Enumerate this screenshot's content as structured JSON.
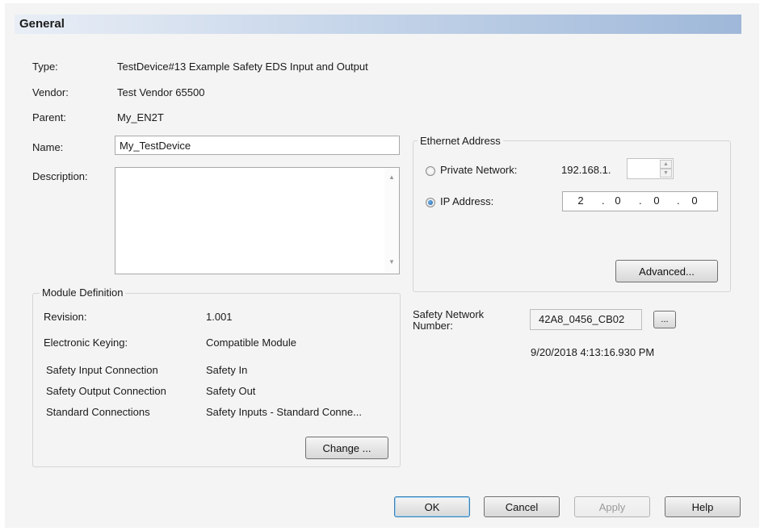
{
  "header": {
    "title": "General"
  },
  "info": {
    "type_label": "Type:",
    "type_value": "TestDevice#13 Example Safety EDS Input and Output",
    "vendor_label": "Vendor:",
    "vendor_value": "Test Vendor 65500",
    "parent_label": "Parent:",
    "parent_value": "My_EN2T",
    "name_label": "Name:",
    "name_value": "My_TestDevice",
    "description_label": "Description:",
    "description_value": ""
  },
  "ethernet": {
    "title": "Ethernet Address",
    "private_label": "Private Network:",
    "private_prefix": "192.168.1.",
    "private_value": "",
    "ip_label": "IP Address:",
    "ip_segments": [
      "2",
      "0",
      "0",
      "0"
    ],
    "selected": "ip",
    "advanced_label": "Advanced..."
  },
  "safety": {
    "label": "Safety Network\nNumber:",
    "label_line1": "Safety Network",
    "label_line2": "Number:",
    "value": "42A8_0456_CB02",
    "browse_label": "...",
    "timestamp": "9/20/2018 4:13:16.930 PM"
  },
  "module": {
    "title": "Module Definition",
    "revision_label": "Revision:",
    "revision_value": "1.001",
    "keying_label": "Electronic Keying:",
    "keying_value": "Compatible Module",
    "rows": [
      {
        "label": "Safety Input Connection",
        "value": "Safety In"
      },
      {
        "label": "Safety Output Connection",
        "value": "Safety Out"
      },
      {
        "label": "Standard Connections",
        "value": "Safety Inputs - Standard Conne..."
      }
    ],
    "change_label": "Change ..."
  },
  "buttons": {
    "ok": "OK",
    "cancel": "Cancel",
    "apply": "Apply",
    "help": "Help"
  }
}
